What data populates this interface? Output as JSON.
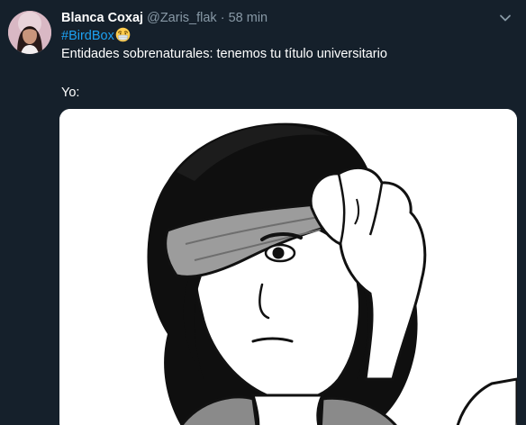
{
  "tweet": {
    "display_name": "Blanca Coxaj",
    "handle": "@Zaris_flak",
    "separator": "·",
    "time": "58 min",
    "hashtag": "#BirdBox",
    "hashtag_emoji": "mask-face-emoji",
    "text_line1": "Entidades sobrenaturales: tenemos tu título universitario",
    "text_line2": "Yo:",
    "avatar_icon": "profile-photo",
    "menu_icon": "chevron-down-icon",
    "media_description_icon": "blindfold-meme-illustration"
  },
  "colors": {
    "background": "#15202b",
    "text": "#ffffff",
    "secondary": "#8899a6",
    "link": "#1da1f2"
  }
}
